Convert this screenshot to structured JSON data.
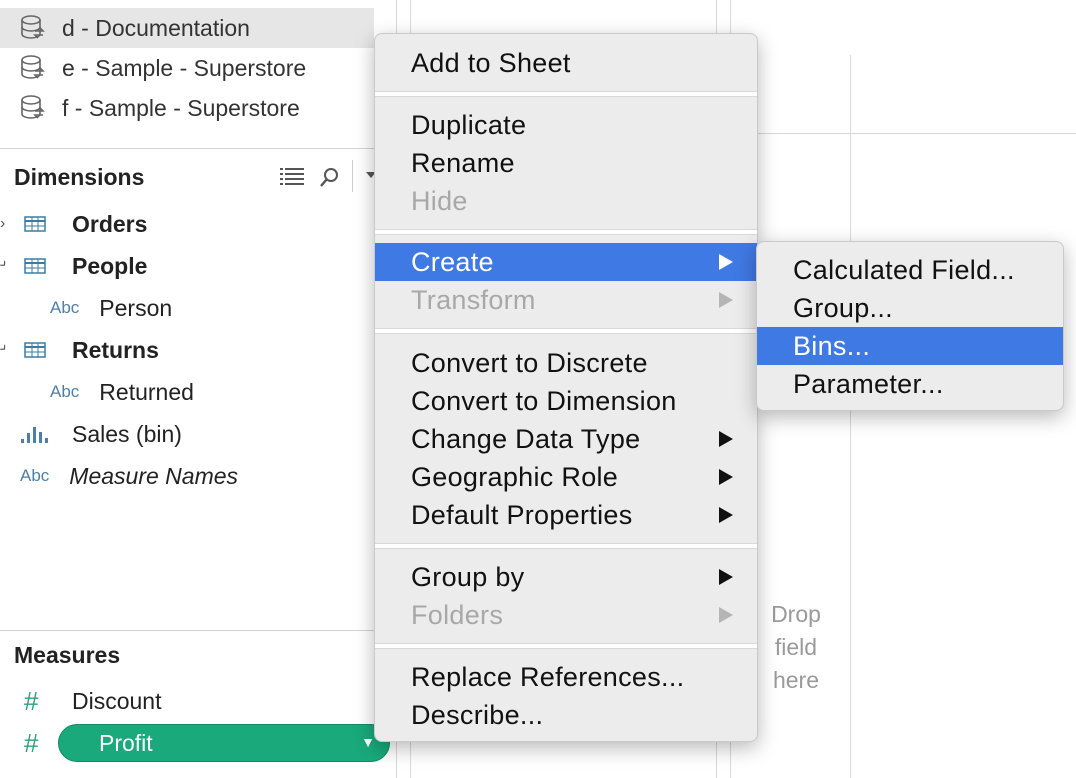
{
  "data_sources": [
    {
      "label": "d - Documentation",
      "selected": true
    },
    {
      "label": "e - Sample - Superstore",
      "selected": false
    },
    {
      "label": "f - Sample - Superstore",
      "selected": false
    }
  ],
  "dimensions": {
    "title": "Dimensions",
    "fields": [
      {
        "label": "Orders",
        "type": "table"
      },
      {
        "label": "People",
        "type": "table"
      },
      {
        "label": "Person",
        "type": "abc"
      },
      {
        "label": "Returns",
        "type": "table"
      },
      {
        "label": "Returned",
        "type": "abc"
      },
      {
        "label": "Sales (bin)",
        "type": "bin"
      },
      {
        "label": "Measure Names",
        "type": "abc"
      }
    ],
    "abc_glyph": "Abc"
  },
  "measures": {
    "title": "Measures",
    "fields": [
      {
        "label": "Discount"
      },
      {
        "label": "Profit"
      }
    ],
    "hash_glyph": "#"
  },
  "workspace": {
    "drop_text": [
      "Drop",
      "field",
      "here"
    ]
  },
  "context_menu": {
    "items": [
      {
        "label": "Add to Sheet"
      },
      {
        "label": "Duplicate"
      },
      {
        "label": "Rename"
      },
      {
        "label": "Hide"
      },
      {
        "label": "Create"
      },
      {
        "label": "Transform"
      },
      {
        "label": "Convert to Discrete"
      },
      {
        "label": "Convert to Dimension"
      },
      {
        "label": "Change Data Type"
      },
      {
        "label": "Geographic Role"
      },
      {
        "label": "Default Properties"
      },
      {
        "label": "Group by"
      },
      {
        "label": "Folders"
      },
      {
        "label": "Replace References..."
      },
      {
        "label": "Describe..."
      }
    ]
  },
  "submenu": {
    "items": [
      {
        "label": "Calculated Field..."
      },
      {
        "label": "Group..."
      },
      {
        "label": "Bins..."
      },
      {
        "label": "Parameter..."
      }
    ]
  },
  "colors": {
    "highlight": "#3f79e3",
    "measure_pill": "#19a97b",
    "abc_blue": "#4e7fa8"
  }
}
